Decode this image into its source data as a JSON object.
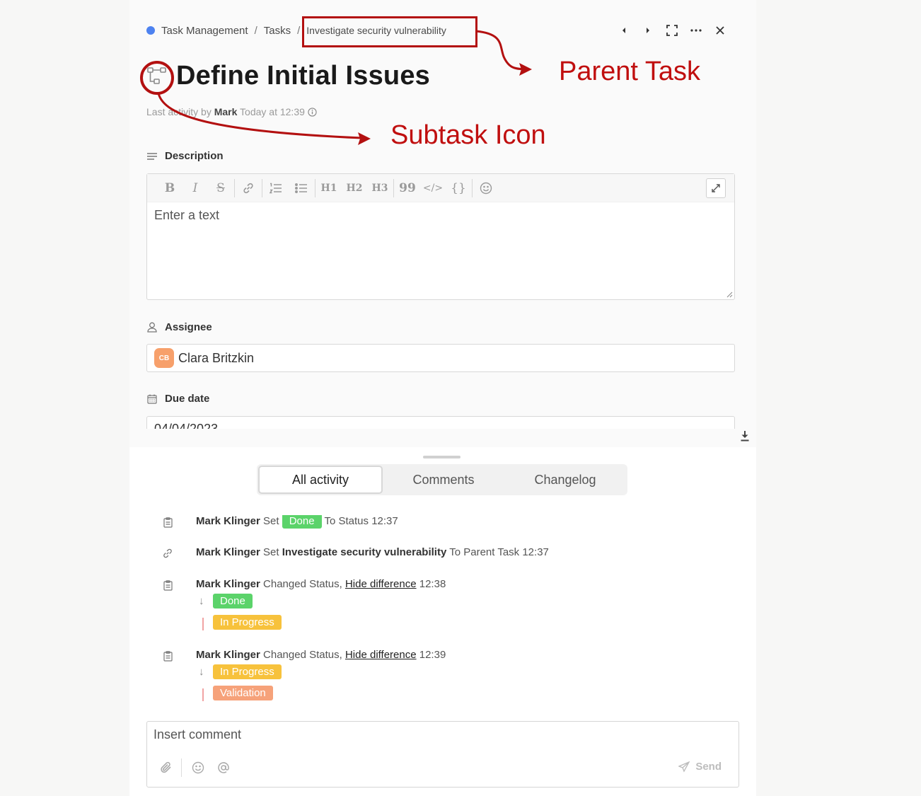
{
  "breadcrumb": {
    "project": "Task Management",
    "separator": "/",
    "section": "Tasks",
    "parent": "Investigate security vulnerability"
  },
  "task": {
    "title": "Define Initial Issues",
    "last_activity_prefix": "Last activity by",
    "last_activity_user": "Mark",
    "last_activity_time": "Today at 12:39"
  },
  "description": {
    "label": "Description",
    "placeholder": "Enter a text",
    "toolbar": {
      "bold": "B",
      "italic": "I",
      "strike": "S",
      "h1": "H1",
      "h2": "H2",
      "h3": "H3",
      "quote": "99",
      "code": "</>",
      "codeblock": "{}"
    }
  },
  "assignee": {
    "label": "Assignee",
    "initials": "CB",
    "name": "Clara Britzkin"
  },
  "due_date": {
    "label": "Due date",
    "value": "04/04/2023"
  },
  "tabs": [
    {
      "label": "All activity",
      "active": true
    },
    {
      "label": "Comments",
      "active": false
    },
    {
      "label": "Changelog",
      "active": false
    }
  ],
  "activity": [
    {
      "user": "Mark Klinger",
      "action": "Set",
      "badge": "Done",
      "suffix": "To Status",
      "time": "12:37"
    },
    {
      "user": "Mark Klinger",
      "action": "Set",
      "target": "Investigate security vulnerability",
      "suffix": "To Parent Task",
      "time": "12:37"
    },
    {
      "user": "Mark Klinger",
      "action": "Changed Status,",
      "link": "Hide difference",
      "time": "12:38",
      "from": "Done",
      "to": "In Progress"
    },
    {
      "user": "Mark Klinger",
      "action": "Changed Status,",
      "link": "Hide difference",
      "time": "12:39",
      "from": "In Progress",
      "to": "Validation"
    }
  ],
  "comment": {
    "placeholder": "Insert comment",
    "send": "Send"
  },
  "annotations": {
    "parent_task": "Parent Task",
    "subtask_icon": "Subtask Icon",
    "color": "#b31010"
  },
  "colors": {
    "project_dot": "#4d82f0",
    "done": "#5bd36a",
    "in_progress": "#f7c23c",
    "validation": "#f6a27a",
    "avatar": "#f7a06b"
  }
}
